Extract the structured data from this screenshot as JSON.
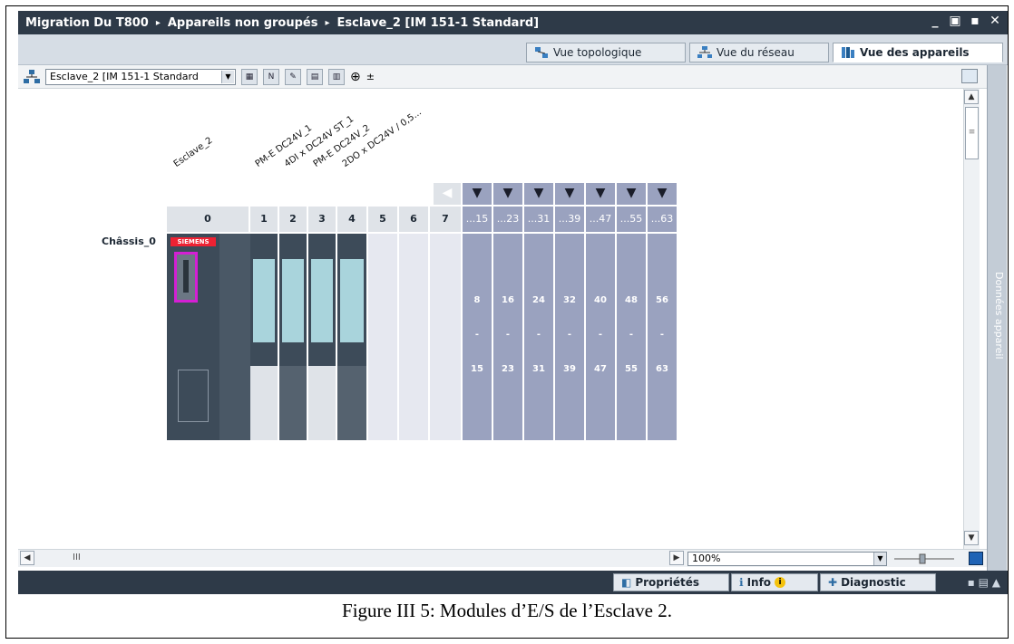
{
  "titlebar": {
    "crumbs": [
      "Migration Du T800",
      "Appareils non groupés",
      "Esclave_2 [IM 151-1 Standard]"
    ],
    "sep": "▸",
    "controls": [
      "_",
      "▣",
      "▪",
      "✕"
    ]
  },
  "view_tabs": [
    {
      "label": "Vue topologique",
      "icon": "topology-icon"
    },
    {
      "label": "Vue du réseau",
      "icon": "network-icon"
    },
    {
      "label": "Vue des appareils",
      "icon": "devices-icon",
      "active": true
    }
  ],
  "toolbar": {
    "device_select": "Esclave_2 [IM 151-1 Standard",
    "dropdown_glyph": "▼",
    "zoom_glyph": "⊕",
    "save_glyph": "±"
  },
  "rack": {
    "name": "Châssis_0",
    "slot_labels": [
      "Esclave_2",
      "PM-E DC24V_1",
      "4DI x DC24V ST_1",
      "PM-E DC24V_2",
      "2DO x DC24V / 0,5..."
    ],
    "columns": [
      "0",
      "1",
      "2",
      "3",
      "4",
      "5",
      "6",
      "7",
      "...15",
      "...23",
      "...31",
      "...39",
      "...47",
      "...55",
      "...63"
    ],
    "expansion_start": [
      "8",
      "16",
      "24",
      "32",
      "40",
      "48",
      "56"
    ],
    "expansion_end": [
      "15",
      "23",
      "31",
      "39",
      "47",
      "55",
      "63"
    ],
    "dash": "-",
    "brand": "SIEMENS"
  },
  "side_panel": {
    "label": "Données appareil"
  },
  "status": {
    "zoom": "100%",
    "scroll_mark": "III"
  },
  "bottom_tabs": [
    {
      "label": "Propriétés"
    },
    {
      "label": "Info"
    },
    {
      "label": "Diagnostic"
    }
  ],
  "caption": "Figure III 5: Modules d’E/S de l’Esclave 2."
}
